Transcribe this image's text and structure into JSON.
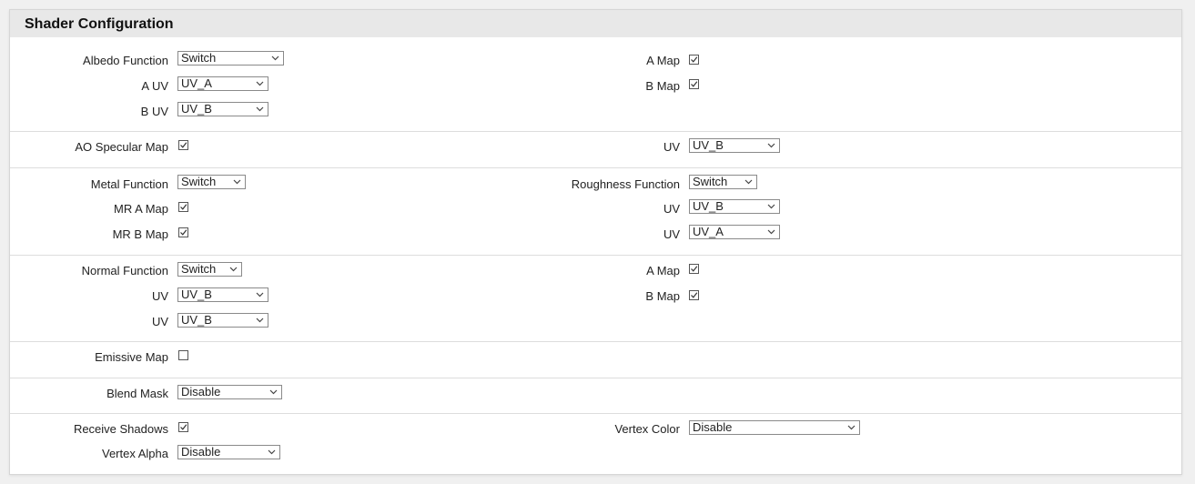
{
  "panel": {
    "title": "Shader Configuration"
  },
  "albedo": {
    "function_label": "Albedo Function",
    "function_value": "Switch",
    "a_uv_label": "A UV",
    "a_uv_value": "UV_A",
    "b_uv_label": "B UV",
    "b_uv_value": "UV_B",
    "a_map_label": "A Map",
    "a_map_checked": true,
    "b_map_label": "B Map",
    "b_map_checked": true
  },
  "ao": {
    "map_label": "AO Specular Map",
    "map_checked": true,
    "uv_label": "UV",
    "uv_value": "UV_B"
  },
  "metal": {
    "function_label": "Metal Function",
    "function_value": "Switch",
    "mr_a_label": "MR A Map",
    "mr_a_checked": true,
    "mr_b_label": "MR B Map",
    "mr_b_checked": true,
    "roughness_label": "Roughness Function",
    "roughness_value": "Switch",
    "uv1_label": "UV",
    "uv1_value": "UV_B",
    "uv2_label": "UV",
    "uv2_value": "UV_A"
  },
  "normal": {
    "function_label": "Normal Function",
    "function_value": "Switch",
    "uv1_label": "UV",
    "uv1_value": "UV_B",
    "uv2_label": "UV",
    "uv2_value": "UV_B",
    "a_map_label": "A Map",
    "a_map_checked": true,
    "b_map_label": "B Map",
    "b_map_checked": true
  },
  "emissive": {
    "label": "Emissive Map",
    "checked": false
  },
  "blend": {
    "label": "Blend Mask",
    "value": "Disable"
  },
  "misc": {
    "receive_shadows_label": "Receive Shadows",
    "receive_shadows_checked": true,
    "vertex_alpha_label": "Vertex Alpha",
    "vertex_alpha_value": "Disable",
    "vertex_color_label": "Vertex Color",
    "vertex_color_value": "Disable"
  },
  "icons": {
    "dropdown": "chevron-down-icon",
    "checkbox": "checkmark-icon"
  },
  "colors": {
    "header_bg": "#e8e8e8",
    "border": "#d6d6d6",
    "separator": "#dddddd"
  }
}
